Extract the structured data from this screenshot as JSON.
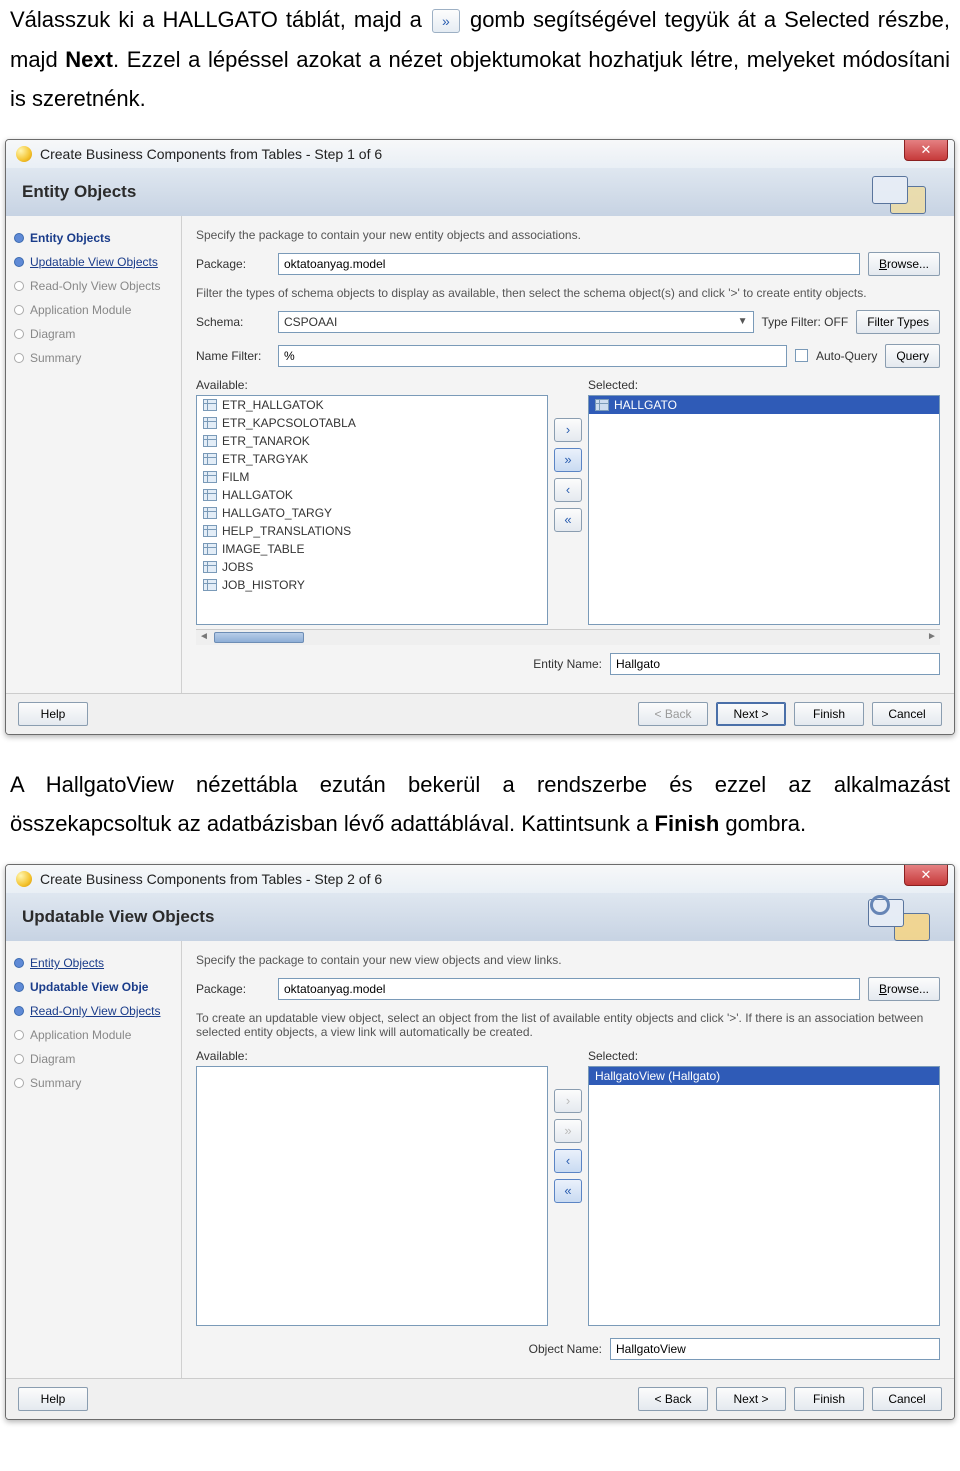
{
  "doc": {
    "p1a": "Válasszuk ki a HALLGATO táblát, majd a",
    "p1b": " gomb segítségével tegyük át a Selected részbe, majd ",
    "next": "Next",
    "p1c": ". Ezzel a lépéssel azokat a nézet objektumokat hozhatjuk létre, melyeket módosítani is szeretnénk.",
    "p2a": "A HallgatoView nézettábla ezután bekerül a rendszerbe és ezzel az alkalmazást összekapcsoltuk az adatbázisban lévő adattáblával. Kattintsunk a ",
    "finish": "Finish",
    "p2b": " gombra."
  },
  "d1": {
    "title": "Create Business Components from Tables - Step 1 of 6",
    "banner": "Entity Objects",
    "nav": [
      "Entity Objects",
      "Updatable View Objects",
      "Read-Only View Objects",
      "Application Module",
      "Diagram",
      "Summary"
    ],
    "hint1": "Specify the package to contain your new entity objects and associations.",
    "packageLbl": "Package:",
    "packageVal": "oktatoanyag.model",
    "browse": "Browse...",
    "hint2": "Filter the types of schema objects to display as available, then select the schema object(s) and click '>' to create entity objects.",
    "schemaLbl": "Schema:",
    "schemaVal": "CSPOAAI",
    "typeFilter": "Type Filter: OFF",
    "filterTypes": "Filter Types",
    "nameFilterLbl": "Name Filter:",
    "nameFilterVal": "%",
    "autoQuery": "Auto-Query",
    "query": "Query",
    "availLbl": "Available:",
    "availItems": [
      "ETR_HALLGATOK",
      "ETR_KAPCSOLOTABLA",
      "ETR_TANAROK",
      "ETR_TARGYAK",
      "FILM",
      "HALLGATOK",
      "HALLGATO_TARGY",
      "HELP_TRANSLATIONS",
      "IMAGE_TABLE",
      "JOBS",
      "JOB_HISTORY"
    ],
    "selLbl": "Selected:",
    "selItems": [
      "HALLGATO"
    ],
    "entityNameLbl": "Entity Name:",
    "entityNameVal": "Hallgato",
    "help": "Help",
    "back": "< Back",
    "nextBtn": "Next >",
    "finishBtn": "Finish",
    "cancel": "Cancel"
  },
  "d2": {
    "title": "Create Business Components from Tables - Step 2 of 6",
    "banner": "Updatable View Objects",
    "nav": [
      "Entity Objects",
      "Updatable View Objects",
      "Read-Only View Objects",
      "Application Module",
      "Diagram",
      "Summary"
    ],
    "hint1": "Specify the package to contain your new view objects and view links.",
    "packageLbl": "Package:",
    "packageVal": "oktatoanyag.model",
    "browse": "Browse...",
    "hint2": "To create an updatable view object, select an object from the list of available entity objects and click '>'.  If there is an association between selected entity objects, a view link will automatically be created.",
    "availLbl": "Available:",
    "selLbl": "Selected:",
    "selItems": [
      "HallgatoView (Hallgato)"
    ],
    "objNameLbl": "Object Name:",
    "objNameVal": "HallgatoView",
    "help": "Help",
    "back": "< Back",
    "nextBtn": "Next >",
    "finishBtn": "Finish",
    "cancel": "Cancel"
  }
}
